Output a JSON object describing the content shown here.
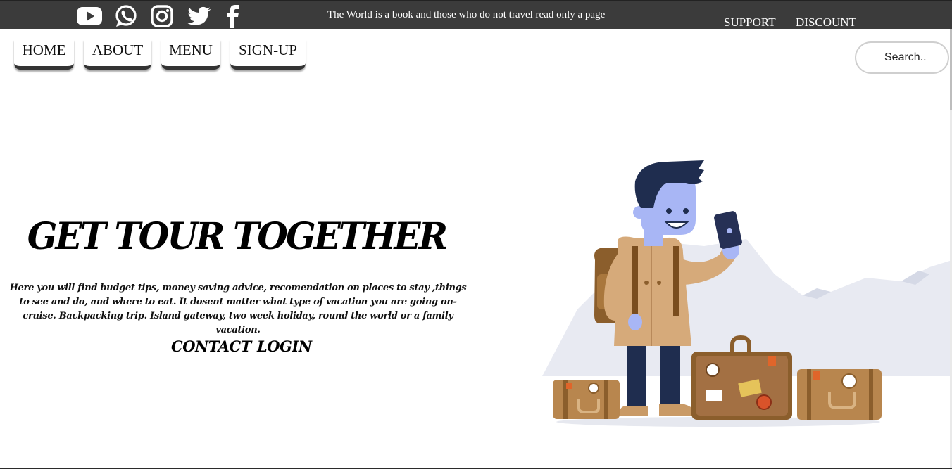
{
  "topbar": {
    "background": "#3b3b3b",
    "social_icons": [
      "youtube-icon",
      "whatsapp-icon",
      "instagram-icon",
      "twitter-icon",
      "facebook-icon"
    ],
    "tagline": "The World is a book and those who do not travel read only a page",
    "links": {
      "support": "SUPPORT",
      "discount": "DISCOUNT"
    }
  },
  "nav": {
    "items": [
      {
        "label": "HOME"
      },
      {
        "label": "ABOUT"
      },
      {
        "label": "MENU"
      },
      {
        "label": "SIGN-UP"
      }
    ]
  },
  "search": {
    "placeholder": "Search.."
  },
  "hero": {
    "title": "GET TOUR TOGETHER",
    "description": "Here you will find budget tips, money saving advice, recomendation on places to stay ,things to see and do, and where to eat. It dosent matter what type of vacation you are going on-cruise. Backpacking trip. Island gateway, two week holiday, round the world or a family vacation.",
    "cta": {
      "contact": "CONTACT",
      "login": "LOGIN"
    }
  },
  "illustration": {
    "name": "traveler-with-suitcases-illustration"
  }
}
